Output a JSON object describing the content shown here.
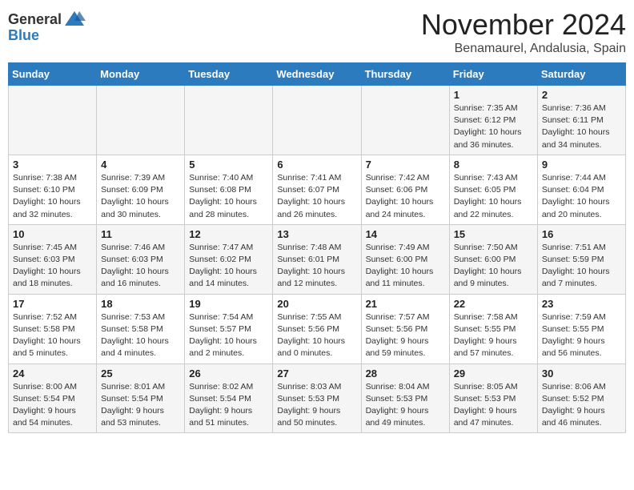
{
  "header": {
    "logo_line1": "General",
    "logo_line2": "Blue",
    "month_title": "November 2024",
    "location": "Benamaurel, Andalusia, Spain"
  },
  "weekdays": [
    "Sunday",
    "Monday",
    "Tuesday",
    "Wednesday",
    "Thursday",
    "Friday",
    "Saturday"
  ],
  "weeks": [
    [
      {
        "day": "",
        "text": ""
      },
      {
        "day": "",
        "text": ""
      },
      {
        "day": "",
        "text": ""
      },
      {
        "day": "",
        "text": ""
      },
      {
        "day": "",
        "text": ""
      },
      {
        "day": "1",
        "text": "Sunrise: 7:35 AM\nSunset: 6:12 PM\nDaylight: 10 hours\nand 36 minutes."
      },
      {
        "day": "2",
        "text": "Sunrise: 7:36 AM\nSunset: 6:11 PM\nDaylight: 10 hours\nand 34 minutes."
      }
    ],
    [
      {
        "day": "3",
        "text": "Sunrise: 7:38 AM\nSunset: 6:10 PM\nDaylight: 10 hours\nand 32 minutes."
      },
      {
        "day": "4",
        "text": "Sunrise: 7:39 AM\nSunset: 6:09 PM\nDaylight: 10 hours\nand 30 minutes."
      },
      {
        "day": "5",
        "text": "Sunrise: 7:40 AM\nSunset: 6:08 PM\nDaylight: 10 hours\nand 28 minutes."
      },
      {
        "day": "6",
        "text": "Sunrise: 7:41 AM\nSunset: 6:07 PM\nDaylight: 10 hours\nand 26 minutes."
      },
      {
        "day": "7",
        "text": "Sunrise: 7:42 AM\nSunset: 6:06 PM\nDaylight: 10 hours\nand 24 minutes."
      },
      {
        "day": "8",
        "text": "Sunrise: 7:43 AM\nSunset: 6:05 PM\nDaylight: 10 hours\nand 22 minutes."
      },
      {
        "day": "9",
        "text": "Sunrise: 7:44 AM\nSunset: 6:04 PM\nDaylight: 10 hours\nand 20 minutes."
      }
    ],
    [
      {
        "day": "10",
        "text": "Sunrise: 7:45 AM\nSunset: 6:03 PM\nDaylight: 10 hours\nand 18 minutes."
      },
      {
        "day": "11",
        "text": "Sunrise: 7:46 AM\nSunset: 6:03 PM\nDaylight: 10 hours\nand 16 minutes."
      },
      {
        "day": "12",
        "text": "Sunrise: 7:47 AM\nSunset: 6:02 PM\nDaylight: 10 hours\nand 14 minutes."
      },
      {
        "day": "13",
        "text": "Sunrise: 7:48 AM\nSunset: 6:01 PM\nDaylight: 10 hours\nand 12 minutes."
      },
      {
        "day": "14",
        "text": "Sunrise: 7:49 AM\nSunset: 6:00 PM\nDaylight: 10 hours\nand 11 minutes."
      },
      {
        "day": "15",
        "text": "Sunrise: 7:50 AM\nSunset: 6:00 PM\nDaylight: 10 hours\nand 9 minutes."
      },
      {
        "day": "16",
        "text": "Sunrise: 7:51 AM\nSunset: 5:59 PM\nDaylight: 10 hours\nand 7 minutes."
      }
    ],
    [
      {
        "day": "17",
        "text": "Sunrise: 7:52 AM\nSunset: 5:58 PM\nDaylight: 10 hours\nand 5 minutes."
      },
      {
        "day": "18",
        "text": "Sunrise: 7:53 AM\nSunset: 5:58 PM\nDaylight: 10 hours\nand 4 minutes."
      },
      {
        "day": "19",
        "text": "Sunrise: 7:54 AM\nSunset: 5:57 PM\nDaylight: 10 hours\nand 2 minutes."
      },
      {
        "day": "20",
        "text": "Sunrise: 7:55 AM\nSunset: 5:56 PM\nDaylight: 10 hours\nand 0 minutes."
      },
      {
        "day": "21",
        "text": "Sunrise: 7:57 AM\nSunset: 5:56 PM\nDaylight: 9 hours\nand 59 minutes."
      },
      {
        "day": "22",
        "text": "Sunrise: 7:58 AM\nSunset: 5:55 PM\nDaylight: 9 hours\nand 57 minutes."
      },
      {
        "day": "23",
        "text": "Sunrise: 7:59 AM\nSunset: 5:55 PM\nDaylight: 9 hours\nand 56 minutes."
      }
    ],
    [
      {
        "day": "24",
        "text": "Sunrise: 8:00 AM\nSunset: 5:54 PM\nDaylight: 9 hours\nand 54 minutes."
      },
      {
        "day": "25",
        "text": "Sunrise: 8:01 AM\nSunset: 5:54 PM\nDaylight: 9 hours\nand 53 minutes."
      },
      {
        "day": "26",
        "text": "Sunrise: 8:02 AM\nSunset: 5:54 PM\nDaylight: 9 hours\nand 51 minutes."
      },
      {
        "day": "27",
        "text": "Sunrise: 8:03 AM\nSunset: 5:53 PM\nDaylight: 9 hours\nand 50 minutes."
      },
      {
        "day": "28",
        "text": "Sunrise: 8:04 AM\nSunset: 5:53 PM\nDaylight: 9 hours\nand 49 minutes."
      },
      {
        "day": "29",
        "text": "Sunrise: 8:05 AM\nSunset: 5:53 PM\nDaylight: 9 hours\nand 47 minutes."
      },
      {
        "day": "30",
        "text": "Sunrise: 8:06 AM\nSunset: 5:52 PM\nDaylight: 9 hours\nand 46 minutes."
      }
    ]
  ]
}
